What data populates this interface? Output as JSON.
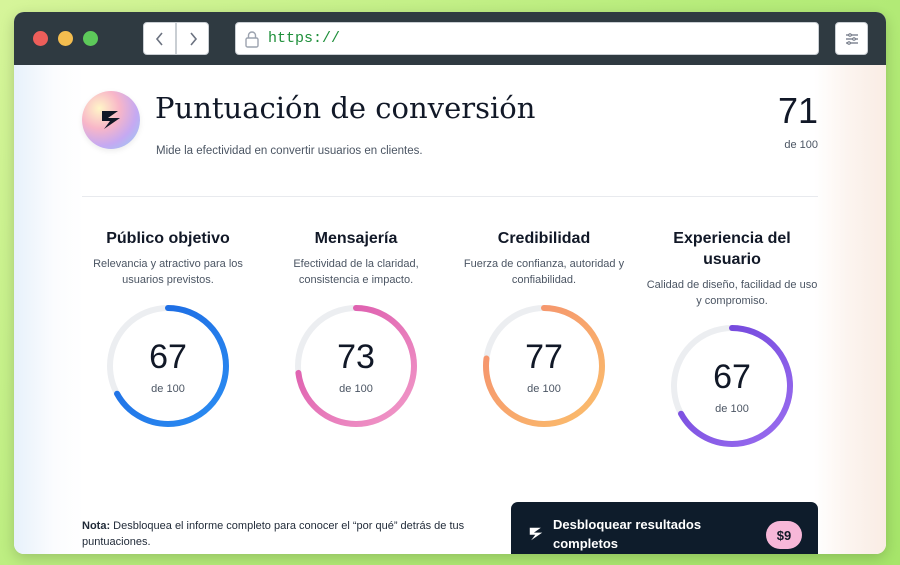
{
  "browser": {
    "url": "https://",
    "icons": {
      "back": "chevron-left-icon",
      "forward": "chevron-right-icon",
      "lock": "lock-icon",
      "menu": "menu-icon"
    }
  },
  "header": {
    "title": "Puntuación de conversión",
    "subtitle": "Mide la efectividad en convertir usuarios en clientes.",
    "total_score": "71",
    "total_of": "de 100"
  },
  "categories": [
    {
      "title": "Público objetivo",
      "description": "Relevancia y atractivo para los usuarios previstos.",
      "score": "67",
      "of": "de 100",
      "value": 67,
      "colors": [
        "#2b8df2",
        "#1a64e0"
      ]
    },
    {
      "title": "Mensajería",
      "description": "Efectividad de la claridad, consistencia e impacto.",
      "score": "73",
      "of": "de 100",
      "value": 73,
      "colors": [
        "#f29bc9",
        "#d94fa8"
      ]
    },
    {
      "title": "Credibilidad",
      "description": "Fuerza de confianza, autoridad y confiabilidad.",
      "score": "77",
      "of": "de 100",
      "value": 77,
      "colors": [
        "#fbbf6b",
        "#f48b6e"
      ]
    },
    {
      "title": "Experiencia del usuario",
      "description": "Calidad de diseño, facilidad de uso y compromiso.",
      "score": "67",
      "of": "de 100",
      "value": 67,
      "colors": [
        "#9b6ef0",
        "#6a3fd8"
      ]
    }
  ],
  "note": {
    "label": "Nota:",
    "text": "Desbloquea el informe completo para conocer el “por qué” detrás de tus puntuaciones."
  },
  "unlock": {
    "label": "Desbloquear resultados completos",
    "price": "$9"
  }
}
